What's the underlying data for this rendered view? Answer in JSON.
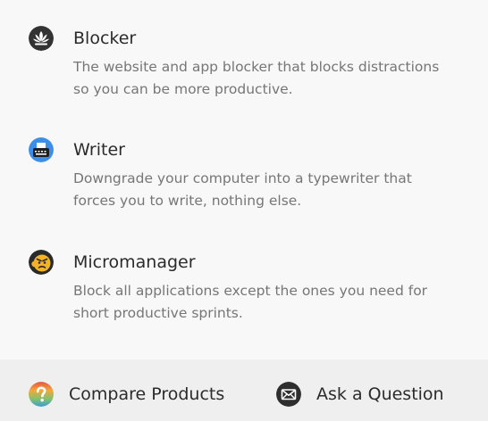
{
  "products": [
    {
      "name": "Blocker",
      "description": "The website and app blocker that blocks distractions so you can be more productive.",
      "icon": "lotus-icon"
    },
    {
      "name": "Writer",
      "description": "Downgrade your computer into a typewriter that forces you to write, nothing else.",
      "icon": "typewriter-icon"
    },
    {
      "name": "Micromanager",
      "description": "Block all applications except the ones you need for short productive sprints.",
      "icon": "angry-face-icon"
    }
  ],
  "footer": {
    "compare_label": "Compare Products",
    "ask_label": "Ask a Question",
    "compare_icon": "question-icon",
    "ask_icon": "envelope-icon"
  },
  "colors": {
    "background": "#f8f8f8",
    "footer_background": "#efefef",
    "title_text": "#2b2b2b",
    "description_text": "#767676"
  }
}
